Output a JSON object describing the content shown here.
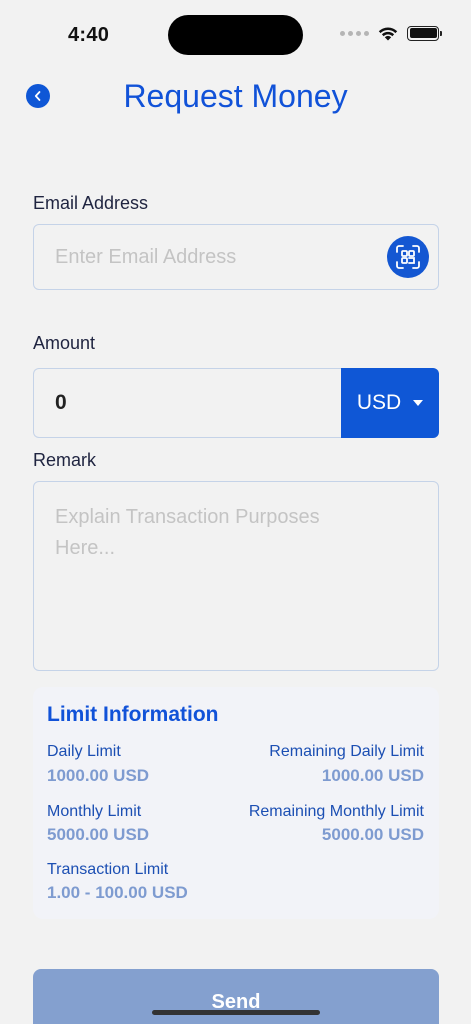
{
  "status_bar": {
    "time": "4:40"
  },
  "header": {
    "title": "Request Money"
  },
  "email": {
    "label": "Email Address",
    "placeholder": "Enter Email Address"
  },
  "amount": {
    "label": "Amount",
    "value": "0",
    "currency": "USD"
  },
  "remark": {
    "label": "Remark",
    "placeholder": "Explain Transaction Purposes\nHere..."
  },
  "limits": {
    "title": "Limit Information",
    "daily_label": "Daily Limit",
    "daily_value": "1000.00 USD",
    "remaining_daily_label": "Remaining Daily Limit",
    "remaining_daily_value": "1000.00 USD",
    "monthly_label": "Monthly Limit",
    "monthly_value": "5000.00 USD",
    "remaining_monthly_label": "Remaining Monthly Limit",
    "remaining_monthly_value": "5000.00 USD",
    "transaction_label": "Transaction Limit",
    "transaction_value": "1.00 - 100.00 USD"
  },
  "actions": {
    "send_label": "Send"
  },
  "colors": {
    "primary": "#0f57d6",
    "title": "#1152d8",
    "send_disabled": "#84a0cf",
    "background": "#f2f2f2"
  },
  "icons": {
    "back": "chevron-left-icon",
    "qr": "qr-scan-icon",
    "wifi": "wifi-icon",
    "battery": "battery-icon",
    "currency_caret": "caret-down-icon"
  }
}
